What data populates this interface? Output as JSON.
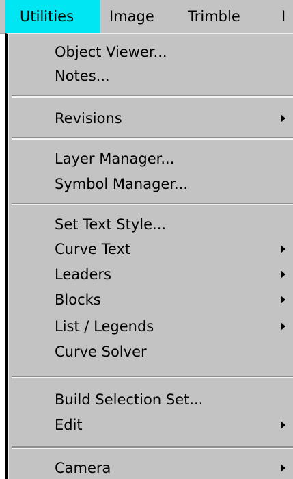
{
  "menubar": {
    "items": [
      {
        "label": "Utilities"
      },
      {
        "label": "Image"
      },
      {
        "label": "Trimble"
      },
      {
        "label": "I"
      }
    ],
    "active_color": "#00e6f2",
    "background_color": "#c3c3c3"
  },
  "dropdown": {
    "items": [
      {
        "label": "Object Viewer...",
        "has_submenu": false
      },
      {
        "label": "Notes...",
        "has_submenu": false
      },
      {
        "label": "Revisions",
        "has_submenu": true
      },
      {
        "label": "Layer Manager...",
        "has_submenu": false
      },
      {
        "label": "Symbol Manager...",
        "has_submenu": false
      },
      {
        "label": "Set Text Style...",
        "has_submenu": false
      },
      {
        "label": "Curve Text",
        "has_submenu": true
      },
      {
        "label": "Leaders",
        "has_submenu": true
      },
      {
        "label": "Blocks",
        "has_submenu": true
      },
      {
        "label": "List / Legends",
        "has_submenu": true
      },
      {
        "label": "Curve Solver",
        "has_submenu": false
      },
      {
        "label": "Build Selection Set...",
        "has_submenu": false
      },
      {
        "label": "Edit",
        "has_submenu": true
      },
      {
        "label": "Camera",
        "has_submenu": true
      }
    ],
    "submenu_icon": "chevron-right-icon"
  }
}
